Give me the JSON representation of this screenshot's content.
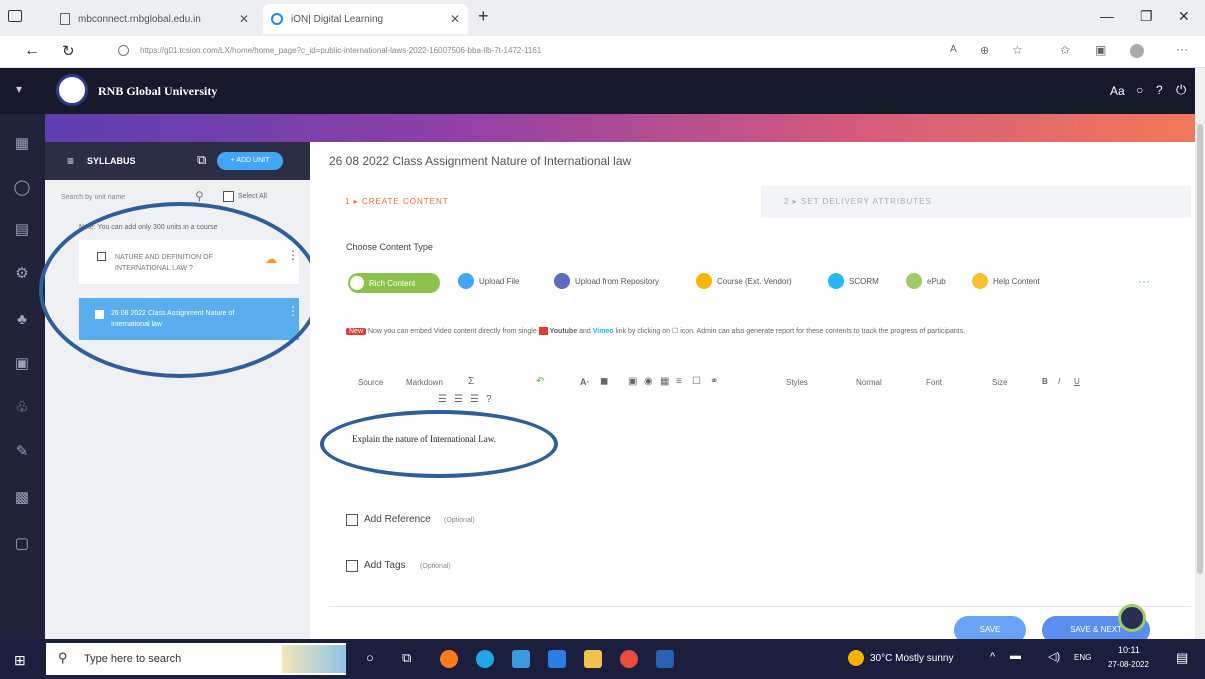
{
  "browser": {
    "tabs": [
      {
        "label": "mbconnect.rnbglobal.edu.in",
        "active": false
      },
      {
        "label": "iON| Digital Learning",
        "active": true
      }
    ],
    "url": "https://g01.tcsion.com/LX/home/home_page?c_id=public-international-laws-2022-16007506-bba-llb-7t-1472-1161"
  },
  "app": {
    "brand": "RNB Global University",
    "header_right": "Aa"
  },
  "syllabus": {
    "title": "SYLLABUS",
    "add_unit": "+ ADD UNIT",
    "search_placeholder": "Search by unit name",
    "select_all": "Select All",
    "note": "Note: You can add only 300 units in a course",
    "units": [
      {
        "label": "NATURE AND DEFINITION OF INTERNATIONAL LAW ?",
        "selected": false
      },
      {
        "label": "26 08 2022 Class Assignment Nature of International law",
        "selected": true
      }
    ]
  },
  "main": {
    "title": "26 08 2022 Class Assignment Nature of International law",
    "step1": "1 ▸ CREATE CONTENT",
    "step2": "2 ▸ SET DELIVERY ATTRIBUTES",
    "content_type_label": "Choose Content Type",
    "content_types": [
      {
        "label": "Rich Content",
        "color": "#8bc34a",
        "selected": true
      },
      {
        "label": "Upload File",
        "color": "#42a5f5"
      },
      {
        "label": "Upload from Repository",
        "color": "#5c6bc0"
      },
      {
        "label": "Course (Ext. Vendor)",
        "color": "#ffb300"
      },
      {
        "label": "SCORM",
        "color": "#29b6f6"
      },
      {
        "label": "ePub",
        "color": "#9ccc65"
      },
      {
        "label": "Help Content",
        "color": "#fbc02d"
      }
    ],
    "more": "···",
    "notice_badge": "New",
    "notice_a": "Now you can embed Video content directly from single",
    "notice_youtube": "Youtube",
    "notice_b": "and",
    "notice_vimeo": "Vimeo",
    "notice_c": "link by clicking on",
    "notice_d": "icon. Admin can also generate report for these contents to track the progress of participants.",
    "toolbar": {
      "source": "Source",
      "markdown": "Markdown",
      "styles": "Styles",
      "normal": "Normal",
      "font": "Font",
      "size": "Size",
      "bold": "B",
      "italic": "I",
      "underline": "U"
    },
    "editor_text": "Explain the nature of International Law.",
    "add_reference": "Add Reference",
    "optional": "(Optional)",
    "add_tags": "Add Tags",
    "save": "SAVE",
    "save_next": "SAVE & NEXT"
  },
  "taskbar": {
    "search_placeholder": "Type here to search",
    "weather": "30°C Mostly sunny",
    "lang": "ENG",
    "time": "10:11",
    "date": "27-08-2022"
  }
}
